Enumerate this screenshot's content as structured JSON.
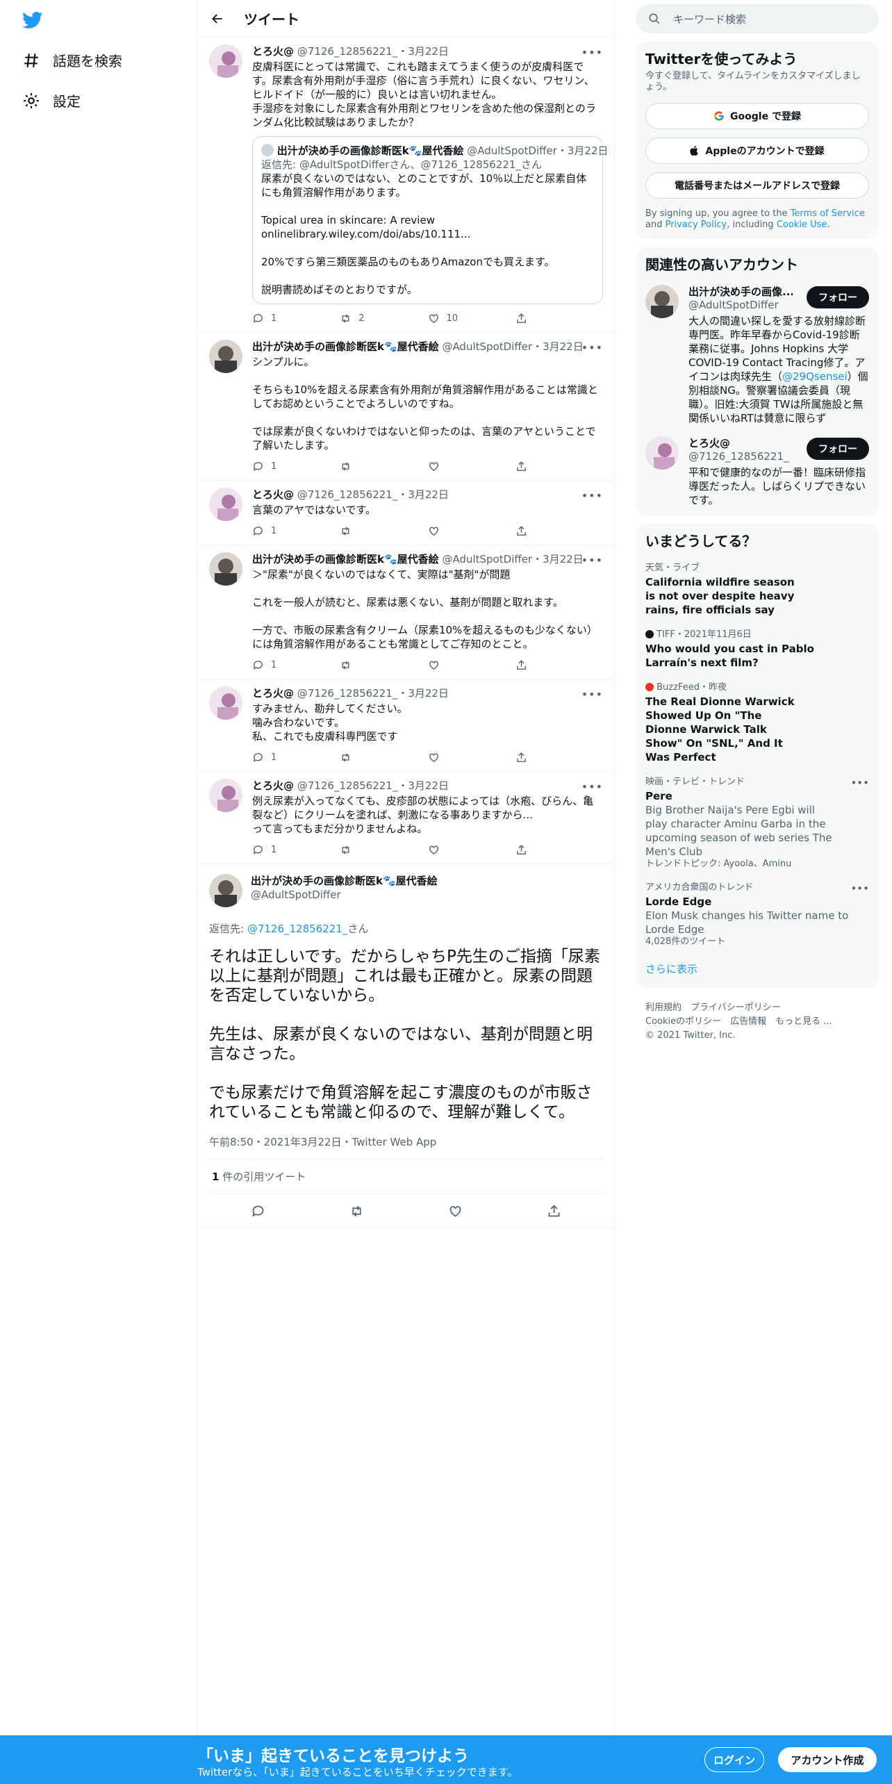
{
  "nav": {
    "search_label": "話題を検索",
    "settings_label": "設定"
  },
  "header": {
    "title": "ツイート"
  },
  "tweets": [
    {
      "name": "とろ火@",
      "handle": "@7126_12856221_",
      "date": "3月22日",
      "text": "皮膚科医にとっては常識で、これも踏まえてうまく使うのが皮膚科医です。尿素含有外用剤が手湿疹（俗に言う手荒れ）に良くない、ワセリン、ヒルドイド（が一般的に）良いとは言い切れません。\n手湿疹を対象にした尿素含有外用剤とワセリンを含めた他の保湿剤とのランダム化比較試験はありましたか？",
      "quote": {
        "name": "出汁が決め手の画像診断医k🐾屋代香絵",
        "handle": "@AdultSpotDiffer",
        "date": "3月22日",
        "reply": "返信先: @AdultSpotDifferさん、@7126_12856221_さん",
        "text": "尿素が良くないのではない、とのことですが、10％以上だと尿素自体にも角質溶解作用があります。\n\nTopical urea in skincare: A review\nonlinelibrary.wiley.com/doi/abs/10.111...\n\n20%ですら第三類医薬品のものもありAmazonでも買えます。\n\n説明書読めばそのとおりですが。"
      },
      "replies": "1",
      "retweets": "2",
      "likes": "10"
    },
    {
      "name": "出汁が決め手の画像診断医k🐾屋代香絵",
      "handle": "@AdultSpotDiffer",
      "date": "3月22日",
      "text": "シンプルに。\n\nそちらも10%を超える尿素含有外用剤が角質溶解作用があることは常識としてお認めということでよろしいのですね。\n\nでは尿素が良くないわけではないと仰ったのは、言葉のアヤということで了解いたします。",
      "replies": "1",
      "retweets": "",
      "likes": ""
    },
    {
      "name": "とろ火@",
      "handle": "@7126_12856221_",
      "date": "3月22日",
      "text": "言葉のアヤではないです。",
      "replies": "1",
      "retweets": "",
      "likes": ""
    },
    {
      "name": "出汁が決め手の画像診断医k🐾屋代香絵",
      "handle": "@AdultSpotDiffer",
      "date": "3月22日",
      "text": "＞\"尿素\"が良くないのではなくて、実際は\"基剤\"が問題\n\nこれを一般人が読むと、尿素は悪くない、基剤が問題と取れます。\n\n一方で、市販の尿素含有クリーム（尿素10%を超えるものも少なくない）には角質溶解作用があることも常識としてご存知のとこと。",
      "replies": "1",
      "retweets": "",
      "likes": ""
    },
    {
      "name": "とろ火@",
      "handle": "@7126_12856221_",
      "date": "3月22日",
      "text": "すみません、勘弁してください。\n噛み合わないです。\n私、これでも皮膚科専門医です",
      "replies": "1",
      "retweets": "",
      "likes": ""
    },
    {
      "name": "とろ火@",
      "handle": "@7126_12856221_",
      "date": "3月22日",
      "text": "例え尿素が入ってなくても、皮疹部の状態によっては（水疱、びらん、亀裂など）にクリームを塗れば、刺激になる事ありますから...\nって言ってもまだ分かりませんよね。",
      "replies": "1",
      "retweets": "",
      "likes": ""
    }
  ],
  "main_tweet": {
    "name": "出汁が決め手の画像診断医k🐾屋代香絵",
    "handle": "@AdultSpotDiffer",
    "reply_prefix": "返信先: ",
    "reply_to": "@7126_12856221_",
    "reply_suffix": "さん",
    "text": "それは正しいです。だからしゃちP先生のご指摘「尿素以上に基剤が問題」これは最も正確かと。尿素の問題を否定していないから。\n\n先生は、尿素が良くないのではない、基剤が問題と明言なさった。\n\nでも尿素だけで角質溶解を起こす濃度のものが市販されていることも常識と仰るので、理解が難しくて。",
    "meta": "午前8:50・2021年3月22日・Twitter Web App",
    "quote_count": "1",
    "quote_label": " 件の引用ツイート"
  },
  "right": {
    "search_placeholder": "キーワード検索",
    "signup": {
      "title": "Twitterを使ってみよう",
      "subtitle": "今すぐ登録して、タイムラインをカスタマイズしましょう。",
      "google": "Google で登録",
      "apple": "Appleのアカウントで登録",
      "phone": "電話番号またはメールアドレスで登録",
      "legal_1": "By signing up, you agree to the ",
      "tos": "Terms of Service",
      "legal_2": " and ",
      "privacy": "Privacy Policy",
      "legal_3": ", including ",
      "cookie": "Cookie Use",
      "legal_4": "."
    },
    "related": {
      "title": "関連性の高いアカウント",
      "accounts": [
        {
          "name": "出汁が決め手の画像...",
          "handle": "@AdultSpotDiffer",
          "follow": "フォロー",
          "bio_1": "大人の間違い探しを愛する放射線診断専門医。昨年早春からCovid-19診断業務に従事。Johns Hopkins 大学 COVID-19 Contact Tracing修了。アイコンは肉球先生（",
          "bio_link": "@29Qsensei",
          "bio_2": "）個別相談NG。警察署協議会委員（現職）。旧姓:大須賀 TWは所属施設と無関係いいねRTは賛意に限らず"
        },
        {
          "name": "とろ火@",
          "handle": "@7126_12856221_",
          "follow": "フォロー",
          "bio_1": "平和で健康的なのが一番！臨床研修指導医だった人。しばらくリプできないです。",
          "bio_link": "",
          "bio_2": ""
        }
      ]
    },
    "trends": {
      "title": "いまどうしてる？",
      "items": [
        {
          "ctx": "天気・ライブ",
          "title": "California wildfire season is not over despite heavy rains, fire officials say",
          "desc": "",
          "extra": ""
        },
        {
          "ctx": "TIFF・2021年11月6日",
          "title": "Who would you cast in Pablo Larraín's next film?",
          "desc": "",
          "extra": ""
        },
        {
          "ctx": "BuzzFeed・昨夜",
          "title": "The Real Dionne Warwick Showed Up On \"The Dionne Warwick Talk Show\" On \"SNL,\" And It Was Perfect",
          "desc": "",
          "extra": ""
        },
        {
          "ctx": "映画・テレビ・トレンド",
          "title": "Pere",
          "desc": "Big Brother Naija's Pere Egbi will play character Aminu Garba in the upcoming season of web series The Men's Club",
          "extra": "トレンドトピック: Ayoola、Aminu"
        },
        {
          "ctx": "アメリカ合衆国のトレンド",
          "title": "Lorde Edge",
          "desc": "Elon Musk changes his Twitter name to Lorde Edge",
          "extra": "4,028件のツイート"
        }
      ],
      "more": "さらに表示"
    },
    "footer": {
      "line1": "利用規約　プライバシーポリシー",
      "line2": "Cookieのポリシー　広告情報　もっと見る ...",
      "line3": "© 2021 Twitter, Inc."
    }
  },
  "bottom": {
    "title": "「いま」起きていることを見つけよう",
    "subtitle": "Twitterなら、「いま」起きていることをいち早くチェックできます。",
    "login": "ログイン",
    "signup": "アカウント作成"
  },
  "colors": {
    "accent": "#1d9bf0",
    "text": "#0f1419",
    "muted": "#536471"
  }
}
